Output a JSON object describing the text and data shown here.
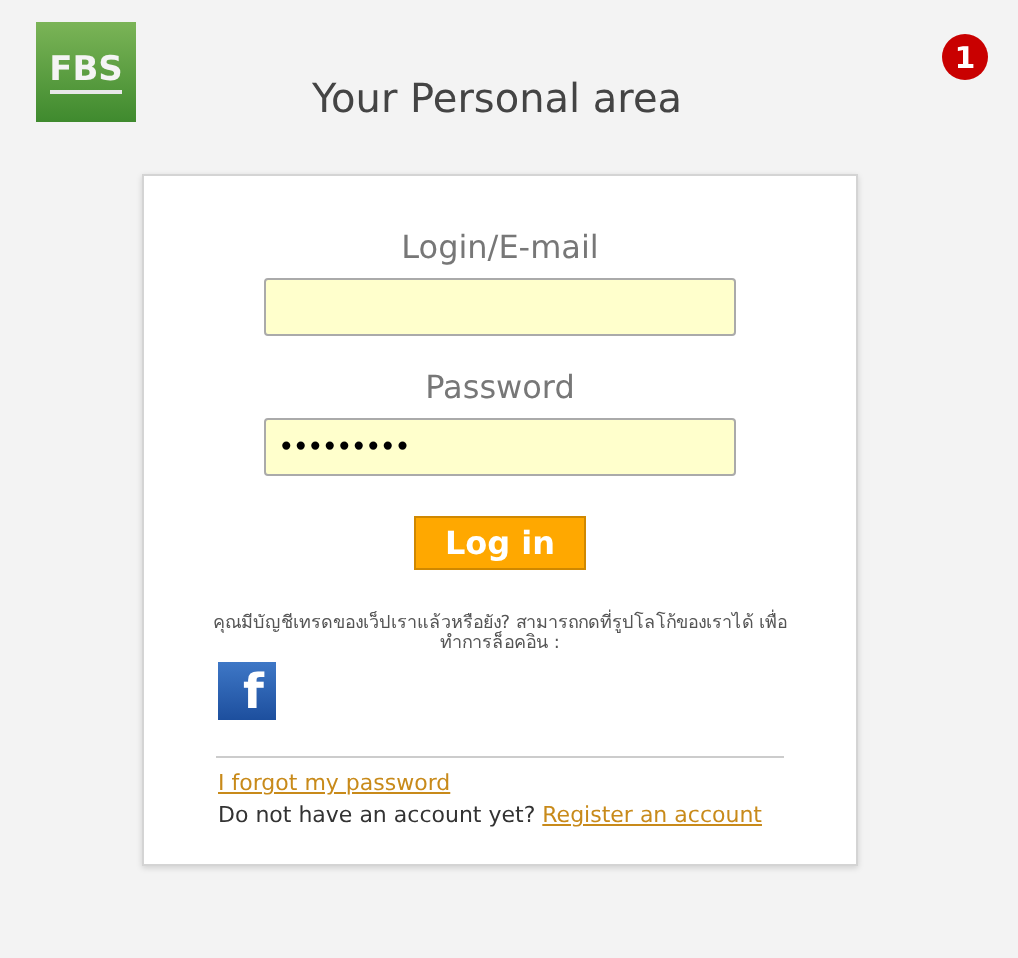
{
  "logo": {
    "text": "FBS"
  },
  "badge": "1",
  "title": "Your Personal area",
  "login": {
    "label": "Login/E-mail"
  },
  "password": {
    "label": "Password",
    "value": "•••••••••"
  },
  "login_button": "Log in",
  "social_text": "คุณมีบัญชีเทรดของเว็ปเราแล้วหรือยัง? สามารถกดที่รูปโลโก้ของเราได้ เพื่อทำการล็อคอิน :",
  "facebook": "f",
  "forgot_link": "I forgot my password",
  "register_text": "Do not have an account yet?",
  "register_link": "Register an account"
}
